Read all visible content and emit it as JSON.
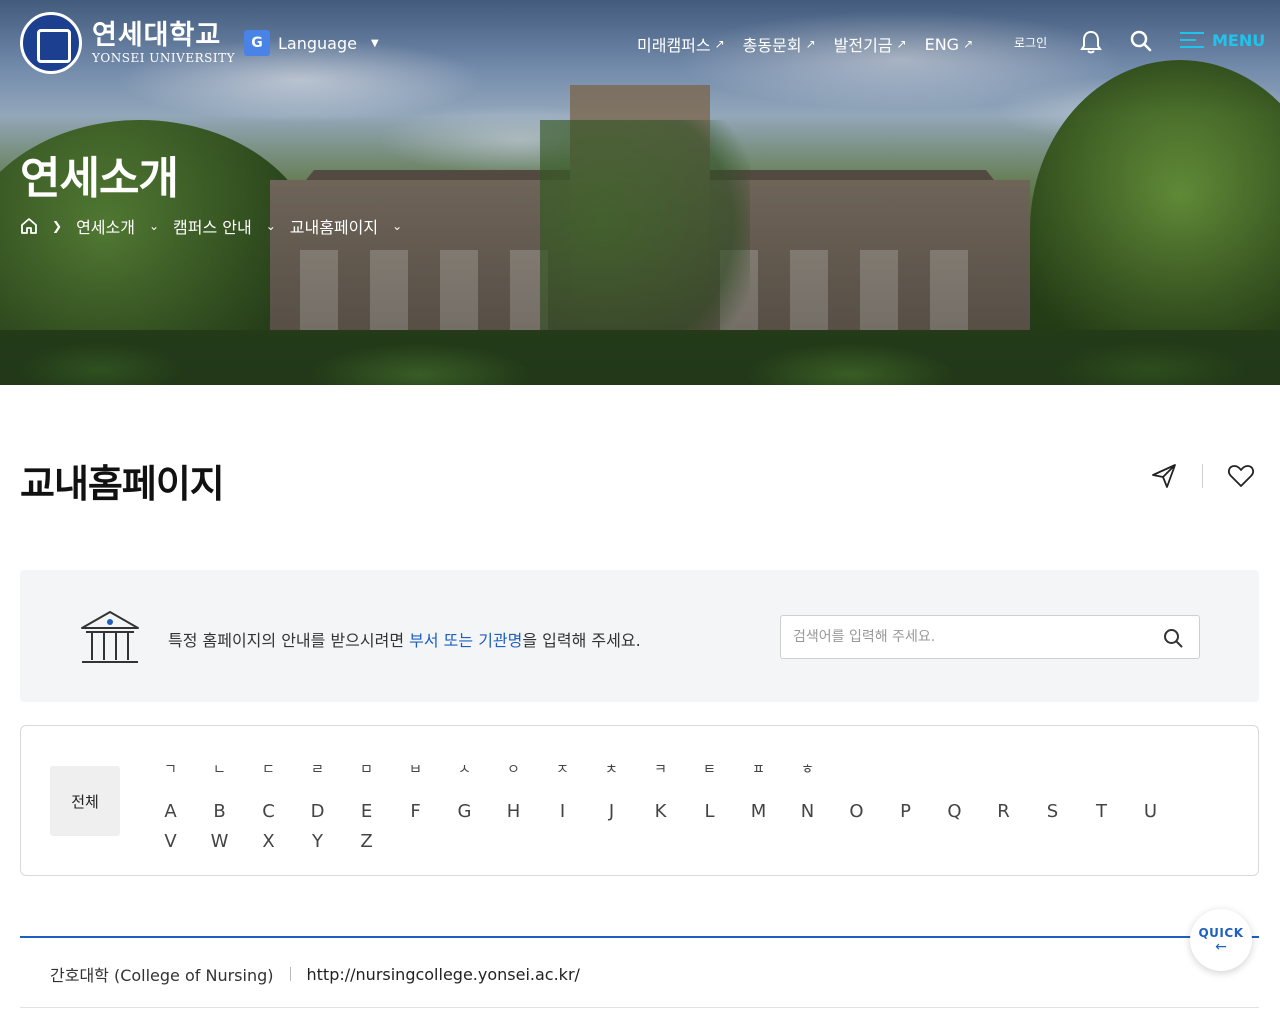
{
  "header": {
    "logo_ko": "연세대학교",
    "logo_en": "YONSEI UNIVERSITY",
    "language_label": "Language",
    "nav": [
      {
        "label": "미래캠퍼스",
        "icon": "external-arrow-icon"
      },
      {
        "label": "총동문회",
        "icon": "external-arrow-icon"
      },
      {
        "label": "발전기금",
        "icon": "external-arrow-icon"
      },
      {
        "label": "ENG",
        "icon": "external-arrow-icon"
      }
    ],
    "login_label": "로그인",
    "menu_label": "MENU"
  },
  "hero": {
    "title": "연세소개",
    "breadcrumb": [
      "연세소개",
      "캠퍼스 안내",
      "교내홈페이지"
    ]
  },
  "page": {
    "title": "교내홈페이지"
  },
  "search": {
    "message_pre": "특정 홈페이지의 안내를 받으시려면 ",
    "message_highlight": "부서 또는 기관명",
    "message_post": "을 입력해 주세요.",
    "placeholder": "검색어를 입력해 주세요."
  },
  "filter": {
    "all_label": "전체",
    "korean": [
      "ㄱ",
      "ㄴ",
      "ㄷ",
      "ㄹ",
      "ㅁ",
      "ㅂ",
      "ㅅ",
      "ㅇ",
      "ㅈ",
      "ㅊ",
      "ㅋ",
      "ㅌ",
      "ㅍ",
      "ㅎ"
    ],
    "latin_row1": [
      "A",
      "B",
      "C",
      "D",
      "E",
      "F",
      "G",
      "H",
      "I",
      "J",
      "K",
      "L",
      "M",
      "N",
      "O",
      "P",
      "Q",
      "R",
      "S",
      "T",
      "U"
    ],
    "latin_row2": [
      "V",
      "W",
      "X",
      "Y",
      "Z"
    ]
  },
  "results": [
    {
      "name": "간호대학 (College of Nursing)",
      "url": "http://nursingcollege.yonsei.ac.kr/"
    }
  ],
  "quick": {
    "label": "QUICK"
  },
  "colors": {
    "accent_blue": "#1f5fc2",
    "menu_cyan": "#22c3ea",
    "panel_gray": "#f3f5f7"
  }
}
